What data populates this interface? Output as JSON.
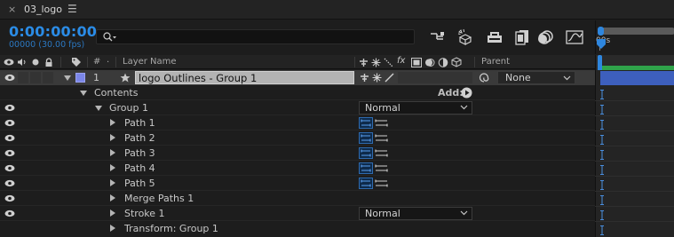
{
  "tab": {
    "close_glyph": "×",
    "title": "03_logo",
    "menu_glyph": "☰"
  },
  "header": {
    "timecode": "0:00:00:00",
    "frame_info": "00000 (30.00 fps)",
    "search": {
      "placeholder": "",
      "value": ""
    },
    "icons": [
      "comp-flowchart-icon",
      "draft-3d-icon",
      "shy-layers-icon",
      "frame-blending-icon",
      "motion-blur-icon",
      "graph-editor-icon"
    ]
  },
  "ruler": {
    "label": "00s"
  },
  "columns": {
    "number": "#",
    "layer_name": "Layer Name",
    "parent": "Parent",
    "switch_fx": "fx"
  },
  "layer": {
    "number": "1",
    "name": "logo Outlines - Group 1",
    "label_color": "#7b86e8",
    "parent_value": "None"
  },
  "contents": {
    "label": "Contents",
    "add_label": "Add:"
  },
  "group": {
    "label": "Group 1",
    "blend_mode": "Normal"
  },
  "paths": [
    {
      "label": "Path 1"
    },
    {
      "label": "Path 2"
    },
    {
      "label": "Path 3"
    },
    {
      "label": "Path 4"
    },
    {
      "label": "Path 5"
    }
  ],
  "merge": {
    "label": "Merge Paths 1"
  },
  "stroke": {
    "label": "Stroke 1",
    "blend_mode": "Normal"
  },
  "transform": {
    "label": "Transform: Group 1"
  },
  "colors": {
    "accent": "#2b8ce6",
    "layer_bar": "#3d5fbd",
    "work_area": "#2fa34a"
  }
}
